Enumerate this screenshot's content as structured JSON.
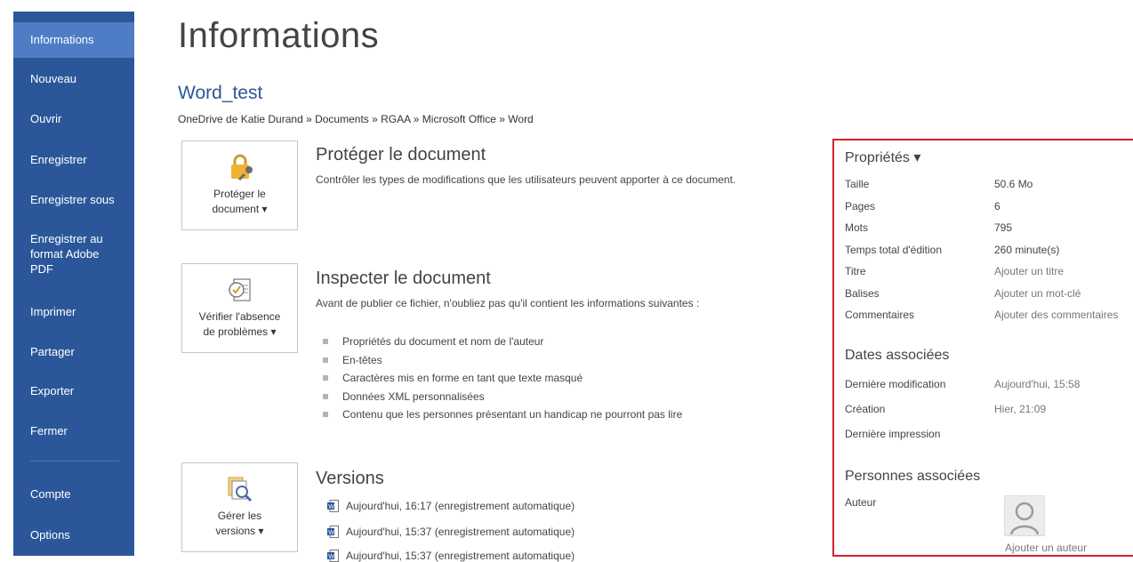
{
  "sidebar": {
    "items": [
      {
        "label": "Informations"
      },
      {
        "label": "Nouveau"
      },
      {
        "label": "Ouvrir"
      },
      {
        "label": "Enregistrer"
      },
      {
        "label": "Enregistrer sous"
      },
      {
        "label": "Enregistrer au format Adobe PDF"
      },
      {
        "label": "Imprimer"
      },
      {
        "label": "Partager"
      },
      {
        "label": "Exporter"
      },
      {
        "label": "Fermer"
      },
      {
        "label": "Compte"
      },
      {
        "label": "Options"
      }
    ]
  },
  "main": {
    "title": "Informations",
    "doc_name": "Word_test",
    "breadcrumb": "OneDrive de Katie Durand » Documents » RGAA » Microsoft Office » Word",
    "protect": {
      "button_line1": "Protéger le",
      "button_line2": "document ▾",
      "title": "Protéger le document",
      "description": "Contrôler les types de modifications que les utilisateurs peuvent apporter à ce document."
    },
    "inspect": {
      "button_line1": "Vérifier l'absence",
      "button_line2": "de problèmes ▾",
      "title": "Inspecter le document",
      "description": "Avant de publier ce fichier, n'oubliez pas qu'il contient les informations suivantes :",
      "items": [
        "Propriétés du document et nom de l'auteur",
        "En-têtes",
        "Caractères mis en forme en tant que texte masqué",
        "Données XML personnalisées",
        "Contenu que les personnes présentant un handicap ne pourront pas lire"
      ]
    },
    "versions": {
      "button_line1": "Gérer les",
      "button_line2": "versions ▾",
      "title": "Versions",
      "items": [
        "Aujourd'hui, 16:17 (enregistrement automatique)",
        "Aujourd'hui, 15:37 (enregistrement automatique)",
        "Aujourd'hui, 15:37 (enregistrement automatique)"
      ]
    }
  },
  "properties": {
    "heading": "Propriétés ▾",
    "rows": [
      {
        "label": "Taille",
        "value": "50.6 Mo"
      },
      {
        "label": "Pages",
        "value": "6"
      },
      {
        "label": "Mots",
        "value": "795"
      },
      {
        "label": "Temps total d'édition",
        "value": "260 minute(s)"
      },
      {
        "label": "Titre",
        "value": "Ajouter un titre"
      },
      {
        "label": "Balises",
        "value": "Ajouter un mot-clé"
      },
      {
        "label": "Commentaires",
        "value": "Ajouter des commentaires"
      }
    ],
    "dates_heading": "Dates associées",
    "dates": [
      {
        "label": "Dernière modification",
        "value": "Aujourd'hui, 15:58"
      },
      {
        "label": "Création",
        "value": "Hier, 21:09"
      },
      {
        "label": "Dernière impression",
        "value": ""
      }
    ],
    "people_heading": "Personnes associées",
    "author_label": "Auteur",
    "add_author": "Ajouter un auteur"
  },
  "colors": {
    "sidebar": "#2b579a",
    "sidebar_active": "#4e7dc6",
    "highlight_border": "#d8232a"
  }
}
